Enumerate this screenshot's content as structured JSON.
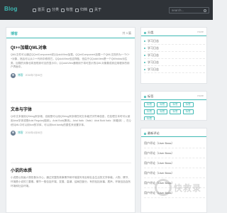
{
  "header": {
    "logo": "Blog",
    "nav": [
      {
        "label": "首页"
      },
      {
        "label": "分类"
      },
      {
        "label": "标签"
      },
      {
        "label": "归档"
      },
      {
        "label": "关于"
      }
    ],
    "search_placeholder": "search..."
  },
  "main": {
    "title": "博客",
    "pager": "共 3 篇",
    "articles": [
      {
        "title": "Qt++加载QML对象",
        "body": "QML文件可以通过QQmlComponent或QQuickView加载。QQmlComponent加载一个QML文档作为一个C++对象，然后可以从C++代码中修改它。QQuickView也这样做，但由于QQuickView是一个QWindow派生类，加载的对象也将呈现到可见的显示中；QQuickView通常用于将可显示的QML对象集成到应用程序的用户界面中。",
        "author": "博客",
        "date": "2018年7月06日"
      },
      {
        "title": "文本与字体",
        "body": "Qt中文本使用QString来存储，也就是可以用QString来存储任何文本格式字符串信息，在处理文本时可以使用Arial字体或是Arial Regular(粗体)，Arial Bold(黑体)，Arial Italic（Italic）Arial Bold Italic（斜粗体）。在Qt的QML中可以用font的字体，可以用font.family的属性来设置字体。",
        "author": "博客",
        "date": "2018年4月06日"
      },
      {
        "title": "小说的本质",
        "body": "小说是以刻画人物形象为中心，通过完整的故事情节和环境描写来反映社会生活的文学体裁。人物、情节、环境是小说的三要素。情节一般包括开端、发展、高潮、结局四部分，有的包括序幕、尾声。环境包括自然环境和社会环境。",
        "author": "",
        "date": ""
      }
    ]
  },
  "sidebar": {
    "panel1": {
      "title": "分类",
      "more": "more",
      "items": [
        "学习日志",
        "学习日志",
        "学习日志",
        "学习日志",
        "学习日志"
      ]
    },
    "panel2": {
      "title": "标签",
      "more": "more",
      "tags": [
        "标签",
        "标签",
        "标签",
        "标签",
        "标签",
        "标签",
        "标签",
        "标签",
        "标签"
      ]
    },
    "panel3": {
      "title": "最新评论",
      "more": "",
      "items": [
        "用户评论（User Bass）",
        "用户评论（User Bass）",
        "用户评论（User Bass）",
        "用户评论（User Bass）",
        "用户评论（User Bass）",
        "用户评论（User Bass）"
      ]
    }
  },
  "watermark": {
    "text": "快救录"
  }
}
